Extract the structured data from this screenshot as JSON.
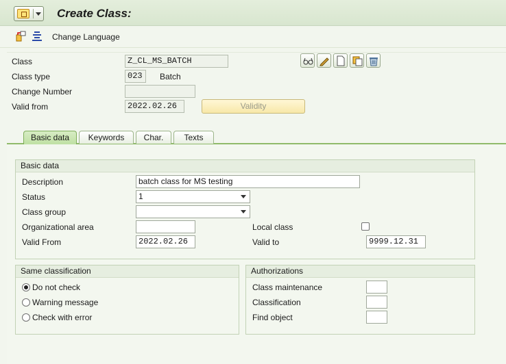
{
  "window": {
    "title": "Create Class:"
  },
  "toolbar": {
    "change_language_label": "Change Language"
  },
  "header": {
    "class_label": "Class",
    "class_value": "Z_CL_MS_BATCH",
    "class_type_label": "Class type",
    "class_type_value": "023",
    "class_type_text": "Batch",
    "change_number_label": "Change Number",
    "change_number_value": "",
    "valid_from_label": "Valid from",
    "valid_from_value": "2022.02.26",
    "validity_button_label": "Validity"
  },
  "header_actions": [
    "glasses-icon",
    "pencil-icon",
    "document-icon",
    "copy-icon",
    "trash-icon"
  ],
  "tabs": [
    {
      "label": "Basic data",
      "active": true
    },
    {
      "label": "Keywords",
      "active": false
    },
    {
      "label": "Char.",
      "active": false
    },
    {
      "label": "Texts",
      "active": false
    }
  ],
  "basic_data": {
    "group_title": "Basic data",
    "description_label": "Description",
    "description_value": "batch class for MS testing",
    "status_label": "Status",
    "status_value": "1",
    "class_group_label": "Class group",
    "class_group_value": "",
    "org_area_label": "Organizational area",
    "org_area_value": "",
    "local_class_label": "Local class",
    "local_class_checked": false,
    "valid_from_label": "Valid From",
    "valid_from_value": "2022.02.26",
    "valid_to_label": "Valid to",
    "valid_to_value": "9999.12.31"
  },
  "same_classification": {
    "group_title": "Same classification",
    "options": [
      {
        "label": "Do not check",
        "selected": true
      },
      {
        "label": "Warning message",
        "selected": false
      },
      {
        "label": "Check with error",
        "selected": false
      }
    ]
  },
  "authorizations": {
    "group_title": "Authorizations",
    "class_maintenance_label": "Class maintenance",
    "class_maintenance_value": "",
    "classification_label": "Classification",
    "classification_value": "",
    "find_object_label": "Find object",
    "find_object_value": ""
  },
  "colors": {
    "active_tab": "#bfe0a3",
    "validity_button": "#f8e8a8",
    "background": "#f2f6ee"
  }
}
